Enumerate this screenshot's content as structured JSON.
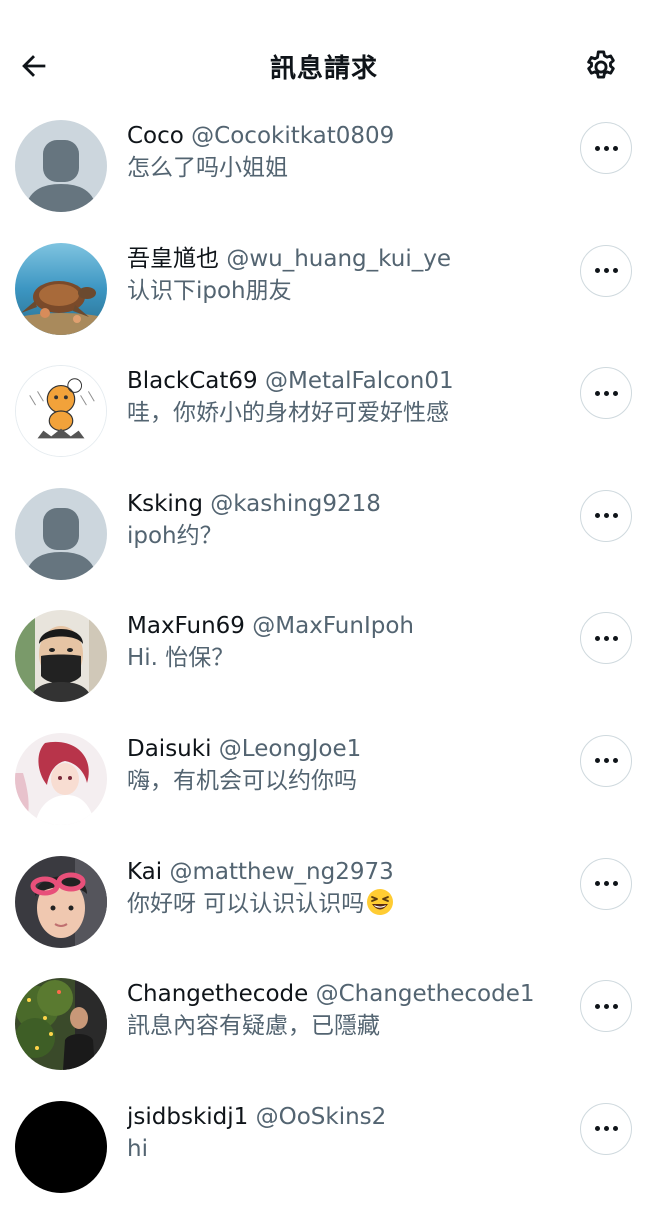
{
  "header": {
    "title": "訊息請求",
    "back_icon": "arrow-left-icon",
    "settings_icon": "gear-icon"
  },
  "requests": [
    {
      "name": "Coco",
      "handle": "@Cocokitkat0809",
      "message": "怎么了吗小姐姐",
      "avatar": "default-avatar"
    },
    {
      "name": "吾皇馗也",
      "handle": "@wu_huang_kui_ye",
      "message": "认识下ipoh朋友",
      "avatar": "turtle-photo"
    },
    {
      "name": "BlackCat69",
      "handle": "@MetalFalcon01",
      "message": "哇，你娇小的身材好可爱好性感",
      "avatar": "cartoon-drawing"
    },
    {
      "name": "Ksking",
      "handle": "@kashing9218",
      "message": "ipoh约？",
      "avatar": "default-avatar"
    },
    {
      "name": "MaxFun69",
      "handle": "@MaxFunIpoh",
      "message": "Hi. 怡保？",
      "avatar": "masked-person-photo"
    },
    {
      "name": "Daisuki",
      "handle": "@LeongJoe1",
      "message": "嗨，有机会可以约你吗",
      "avatar": "anime-girl-art"
    },
    {
      "name": "Kai",
      "handle": "@matthew_ng2973",
      "message": "你好呀 可以认识认识吗",
      "message_emoji": "grinning-squinting-face-emoji",
      "avatar": "person-with-sunglasses-photo"
    },
    {
      "name": "Changethecode",
      "handle": "@Changethecode1",
      "message": "訊息內容有疑慮，已隱藏",
      "avatar": "person-with-christmas-tree-photo"
    },
    {
      "name": "jsidbskidj1",
      "handle": "@OoSkins2",
      "message": "hi",
      "avatar": "black-avatar"
    }
  ],
  "more_icon": "more-horizontal-icon"
}
